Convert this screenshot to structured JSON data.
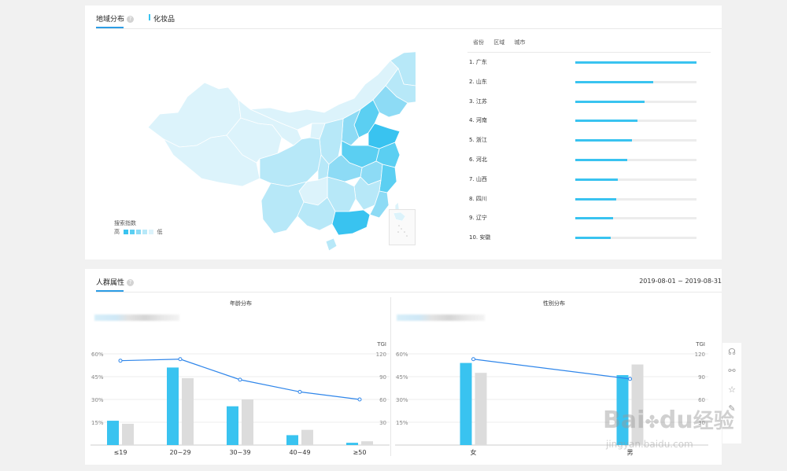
{
  "region_panel": {
    "title": "地域分布",
    "help": "?",
    "category": "化妆品",
    "tabs": [
      "省份",
      "区域",
      "城市"
    ],
    "legend": {
      "title": "搜索指数",
      "high": "高",
      "low": "低",
      "colors": [
        "#39c3f0",
        "#5bcff2",
        "#8ddbf5",
        "#b7e8f8",
        "#dcf3fb"
      ]
    },
    "ranking": [
      {
        "label": "1.  广东",
        "value": 100
      },
      {
        "label": "2.  山东",
        "value": 64
      },
      {
        "label": "3.  江苏",
        "value": 57
      },
      {
        "label": "4.  河南",
        "value": 51
      },
      {
        "label": "5.  浙江",
        "value": 47
      },
      {
        "label": "6.  河北",
        "value": 43
      },
      {
        "label": "7.  山西",
        "value": 35
      },
      {
        "label": "8.  四川",
        "value": 34
      },
      {
        "label": "9.  辽宁",
        "value": 31
      },
      {
        "label": "10. 安徽",
        "value": 29
      }
    ],
    "inset_label": "南海诸岛"
  },
  "crowd_panel": {
    "title": "人群属性",
    "help": "?",
    "date_range": "2019-08-01 ~ 2019-08-31"
  },
  "side_tools": [
    "headset-icon",
    "share-icon",
    "star-icon",
    "edit-icon"
  ],
  "watermark": {
    "brand": "Bai",
    "brand2": "du",
    "cn": "经验",
    "url": "jingyan.baidu.com"
  },
  "colors": {
    "accent": "#2c9ce4",
    "bar_primary": "#39c3f0",
    "bar_secondary": "#dcdcdc",
    "line": "#2f86ea"
  },
  "chart_data": [
    {
      "type": "bar",
      "title": "年龄分布",
      "categories": [
        "≤19",
        "20~29",
        "30~39",
        "40~49",
        "≥50"
      ],
      "series": [
        {
          "values": [
            16,
            51,
            25.5,
            6.5,
            1.5
          ]
        },
        {
          "values": [
            14,
            44,
            30,
            10,
            2.5
          ]
        }
      ],
      "line_series": {
        "name": "TGI",
        "values": [
          111,
          113,
          86,
          70,
          60
        ]
      },
      "y_left": {
        "ticks": [
          "60%",
          "45%",
          "30%",
          "15%"
        ],
        "lim": [
          0,
          60
        ]
      },
      "y_right": {
        "label": "TGI",
        "ticks": [
          "120",
          "90",
          "60",
          "30"
        ],
        "lim": [
          0,
          120
        ]
      },
      "grid": true
    },
    {
      "type": "bar",
      "title": "性别分布",
      "categories": [
        "女",
        "男"
      ],
      "series": [
        {
          "values": [
            54,
            46
          ]
        },
        {
          "values": [
            47.5,
            53
          ]
        }
      ],
      "line_series": {
        "name": "TGI",
        "values": [
          113,
          87
        ]
      },
      "y_left": {
        "ticks": [
          "60%",
          "45%",
          "30%",
          "15%"
        ],
        "lim": [
          0,
          60
        ]
      },
      "y_right": {
        "label": "TGI",
        "ticks": [
          "120",
          "90",
          "60",
          "30"
        ],
        "lim": [
          0,
          120
        ]
      },
      "grid": true
    }
  ]
}
